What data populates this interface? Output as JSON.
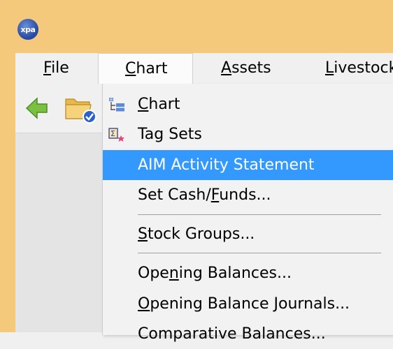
{
  "app": {
    "icon_text": "xpa"
  },
  "menubar": {
    "items": [
      {
        "key": "file",
        "pre": "",
        "u": "F",
        "post": "ile"
      },
      {
        "key": "chart",
        "pre": "",
        "u": "C",
        "post": "hart"
      },
      {
        "key": "assets",
        "pre": "",
        "u": "A",
        "post": "ssets"
      },
      {
        "key": "livestock",
        "pre": "",
        "u": "L",
        "post": "ivestock"
      }
    ]
  },
  "toolbar": {
    "back_icon": "back-arrow-icon",
    "folder_icon": "open-folder-check-icon"
  },
  "dropdown": {
    "items": [
      {
        "pre": "",
        "u": "C",
        "post": "hart",
        "icon": "chart-tree-icon"
      },
      {
        "pre": "",
        "u": "",
        "post": "Tag Sets",
        "icon": "tag-sets-icon"
      },
      {
        "pre": "",
        "u": "",
        "post": "AIM Activity Statement",
        "highlighted": true
      },
      {
        "pre": "Set Cash/",
        "u": "F",
        "post": "unds..."
      },
      {
        "pre": "",
        "u": "S",
        "post": "tock Groups..."
      },
      {
        "pre": "Ope",
        "u": "n",
        "post": "ing Balances..."
      },
      {
        "pre": "",
        "u": "O",
        "post": "pening Balance Journals..."
      },
      {
        "pre": "Comparative Balances...",
        "u": "",
        "post": ""
      }
    ]
  },
  "colors": {
    "titlebar": "#f5c97b",
    "highlight": "#3399ff"
  }
}
